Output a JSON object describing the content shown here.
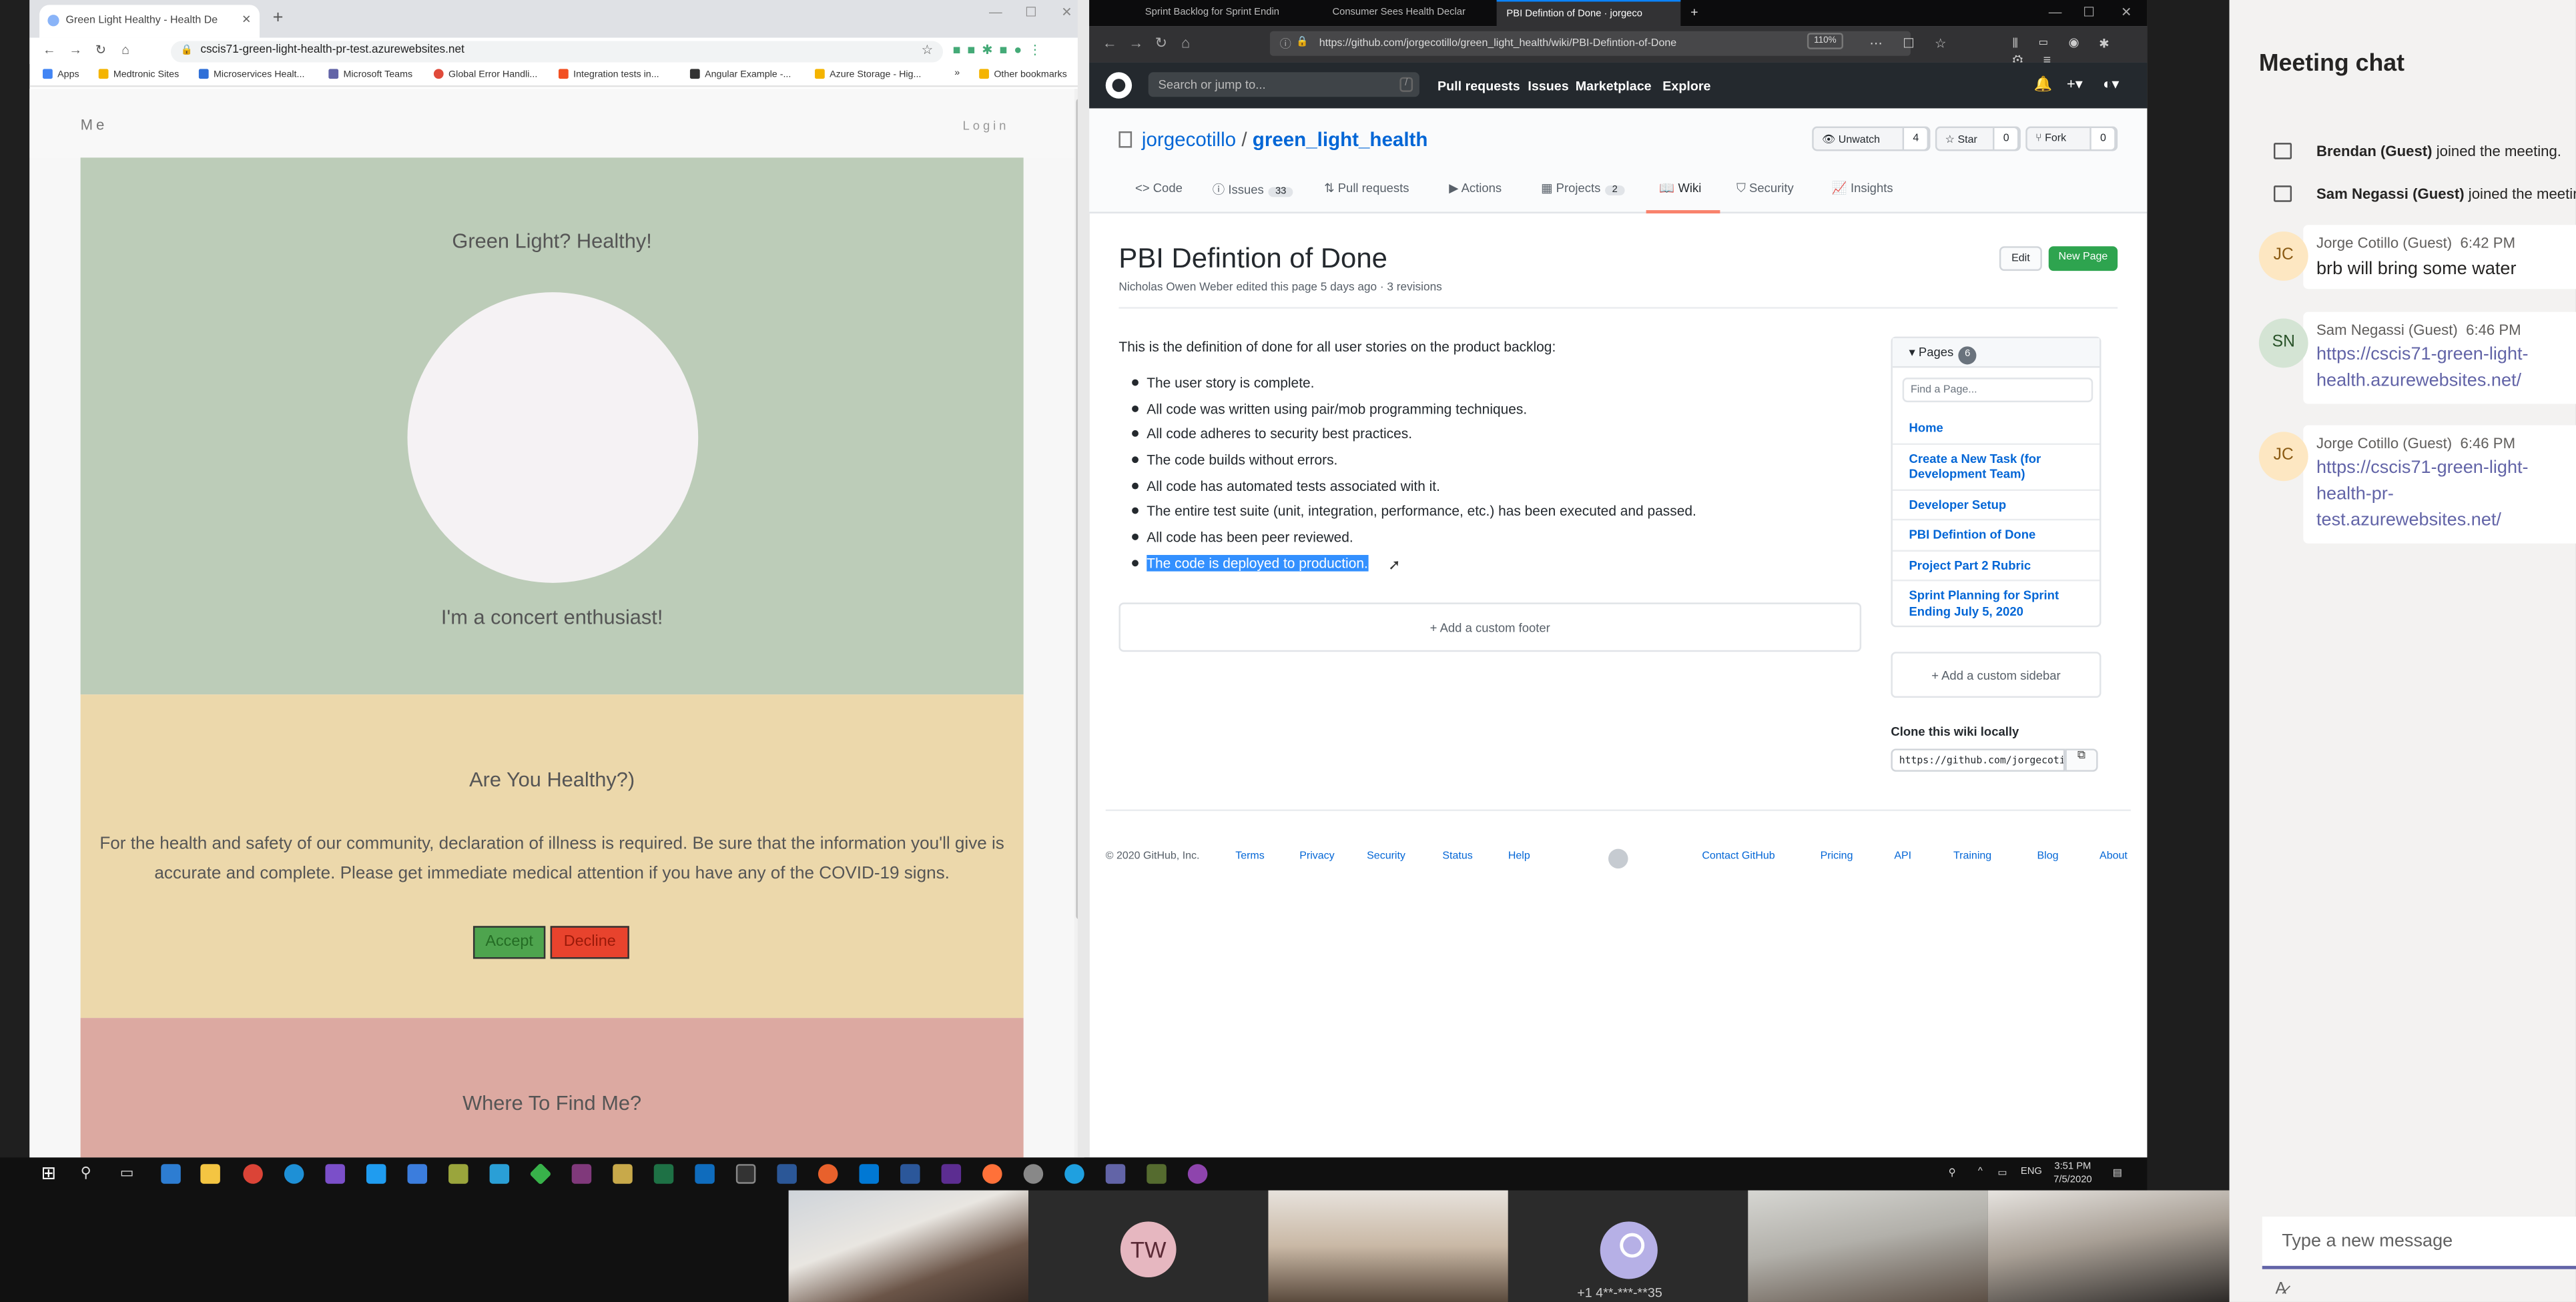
{
  "chrome": {
    "tab_title": "Green Light Healthy - Health De",
    "url": "cscis71-green-light-health-pr-test.azurewebsites.net",
    "bookmarks": [
      "Apps",
      "Medtronic Sites",
      "Microservices Healt...",
      "Microsoft Teams",
      "Global Error Handli...",
      "Integration tests in...",
      "Angular Example -...",
      "Azure Storage - Hig...",
      "Other bookmarks"
    ],
    "bookmark_more": "»"
  },
  "app": {
    "brand": "Me",
    "login": "Login",
    "hero_title": "Green Light? Healthy!",
    "hero_tagline": "I'm a concert enthusiast!",
    "health_title": "Are You Healthy?)",
    "health_text": "For the health and safety of our community, declaration of illness is required. Be sure that the information you'll give is accurate and complete. Please get immediate medical attention if you have any of the COVID-19 signs.",
    "accept_label": "Accept",
    "decline_label": "Decline",
    "find_title": "Where To Find Me?"
  },
  "firefox": {
    "tabs": [
      "Sprint Backlog for Sprint Endin",
      "Consumer Sees Health Declar",
      "PBI Defintion of Done · jorgeco"
    ],
    "url": "https://github.com/jorgecotillo/green_light_health/wiki/PBI-Defintion-of-Done",
    "zoom": "110%"
  },
  "github": {
    "search_placeholder": "Search or jump to...",
    "search_key": "/",
    "nav": [
      "Pull requests",
      "Issues",
      "Marketplace",
      "Explore"
    ],
    "owner": "jorgecotillo",
    "repo": "green_light_health",
    "unwatch": "Unwatch",
    "unwatch_count": "4",
    "star": "Star",
    "star_count": "0",
    "fork": "Fork",
    "fork_count": "0",
    "tabs": [
      {
        "label": "Code",
        "count": ""
      },
      {
        "label": "Issues",
        "count": "33"
      },
      {
        "label": "Pull requests",
        "count": ""
      },
      {
        "label": "Actions",
        "count": ""
      },
      {
        "label": "Projects",
        "count": "2"
      },
      {
        "label": "Wiki",
        "count": ""
      },
      {
        "label": "Security",
        "count": ""
      },
      {
        "label": "Insights",
        "count": ""
      }
    ],
    "wiki_title": "PBI Defintion of Done",
    "wiki_meta": "Nicholas Owen Weber edited this page 5 days ago · 3 revisions",
    "edit_label": "Edit",
    "new_page_label": "New Page",
    "intro": "This is the definition of done for all user stories on the product backlog:",
    "criteria": [
      "The user story is complete.",
      "All code was written using pair/mob programming techniques.",
      "All code adheres to security best practices.",
      "The code builds without errors.",
      "All code has automated tests associated with it.",
      "The entire test suite (unit, integration, performance, etc.) has been executed and passed.",
      "All code has been peer reviewed.",
      "The code is deployed to production."
    ],
    "add_footer": "Add a custom footer",
    "pages_label": "Pages",
    "pages_count": "6",
    "find_page_placeholder": "Find a Page...",
    "pages": [
      "Home",
      "Create a New Task (for Development Team)",
      "Developer Setup",
      "PBI Defintion of Done",
      "Project Part 2 Rubric",
      "Sprint Planning for Sprint Ending July 5, 2020"
    ],
    "add_sidebar": "Add a custom sidebar",
    "clone_title": "Clone this wiki locally",
    "clone_url": "https://github.com/jorgecotillo/green_light_health.wiki.git",
    "footer_copy": "© 2020 GitHub, Inc.",
    "footer_links_left": [
      "Terms",
      "Privacy",
      "Security",
      "Status",
      "Help"
    ],
    "footer_links_right": [
      "Contact GitHub",
      "Pricing",
      "API",
      "Training",
      "Blog",
      "About"
    ]
  },
  "taskbar": {
    "lang": "ENG",
    "time": "3:51 PM",
    "date": "7/5/2020"
  },
  "video": {
    "tw_initials": "TW",
    "phone": "+1 4**-***-**35"
  },
  "chat": {
    "title": "Meeting chat",
    "system": [
      {
        "name": "Brendan (Guest)",
        "text": " joined the meeting."
      },
      {
        "name": "Sam Negassi (Guest)",
        "text": " joined the meeting."
      }
    ],
    "messages": [
      {
        "initials": "JC",
        "author": "Jorge Cotillo (Guest)",
        "time": "6:42 PM",
        "text": "brb will bring some water",
        "link": ""
      },
      {
        "initials": "SN",
        "author": "Sam Negassi (Guest)",
        "time": "6:46 PM",
        "text": "",
        "link": "https://cscis71-green-light-health.azurewebsites.net/"
      },
      {
        "initials": "JC",
        "author": "Jorge Cotillo (Guest)",
        "time": "6:46 PM",
        "text": "",
        "link": "https://cscis71-green-light-health-pr-test.azurewebsites.net/"
      }
    ],
    "compose_placeholder": "Type a new message"
  },
  "colors": {
    "accent_teams": "#6264a7",
    "gh_green": "#2ea44f",
    "hero_green": "#bcccb8",
    "health_yellow": "#ecd8ab",
    "find_red": "#dca9a1"
  }
}
